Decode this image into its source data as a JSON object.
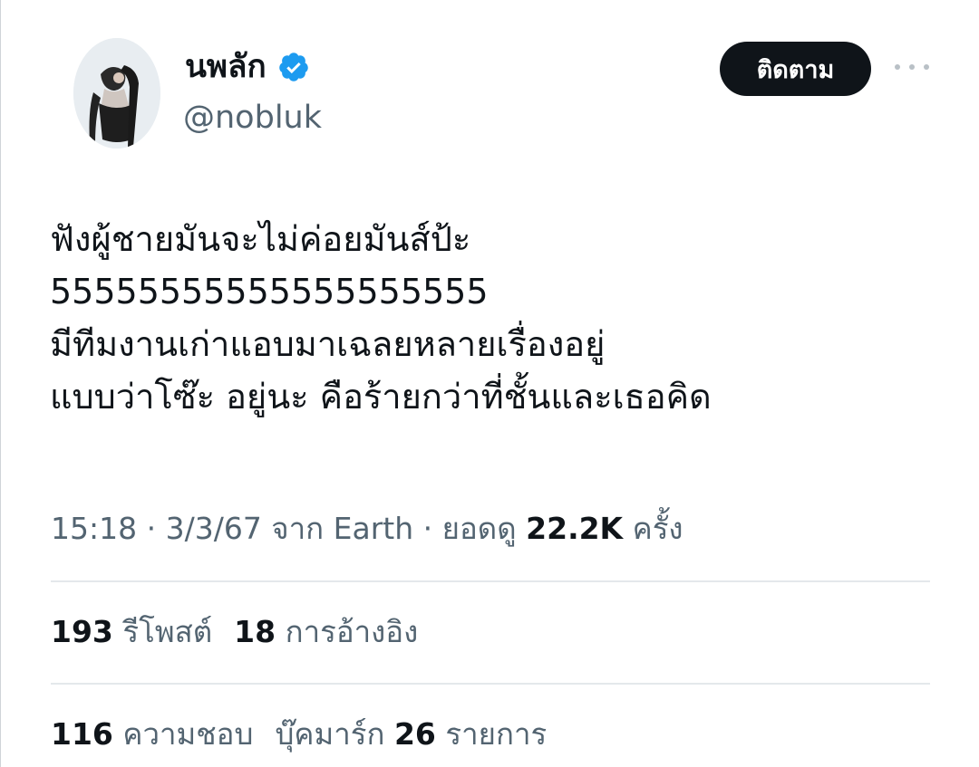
{
  "author": {
    "display_name": "นพลัก",
    "handle": "@nobluk",
    "verified": true,
    "avatar_icon": "profile-photo"
  },
  "actions": {
    "follow_label": "ติดตาม",
    "more_icon": "more-dots-icon"
  },
  "tweet": {
    "lines": [
      "ฟังผู้ชายมันจะไม่ค่อยมันส์ป้ะ",
      "55555555555555555555",
      "มีทีมงานเก่าแอบมาเฉลยหลายเรื่องอยู่",
      "แบบว่าโซ๊ะ อยู่นะ คือร้ายกว่าที่ชั้นและเธอคิด"
    ]
  },
  "meta": {
    "time": "15:18",
    "sep1": " · ",
    "date": "3/3/67",
    "source": " จาก Earth",
    "sep2": " · ",
    "views_label": "ยอดดู ",
    "views_count": "22.2K",
    "views_suffix": " ครั้ง"
  },
  "stats": {
    "retweets_count": "193",
    "retweets_label": " รีโพสต์",
    "quotes_count": "18",
    "quotes_label": " การอ้างอิง",
    "likes_count": "116",
    "likes_label": " ความชอบ",
    "bookmarks_label": "บุ๊คมาร์ก ",
    "bookmarks_count": "26",
    "bookmarks_suffix": " รายการ"
  },
  "colors": {
    "verified_blue": "#1d9bf0",
    "text_primary": "#0f1419",
    "text_secondary": "#536471",
    "follow_bg": "#0f1419"
  }
}
